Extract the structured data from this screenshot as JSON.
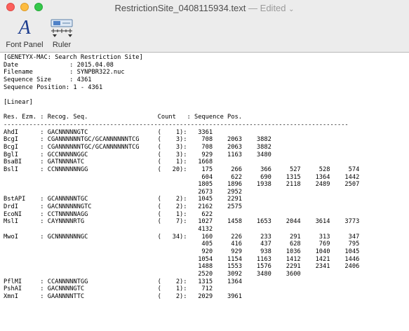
{
  "window": {
    "title": "RestrictionSite_0408115934.text",
    "separator": "—",
    "status": "Edited",
    "status_chevron": "⌄"
  },
  "toolbar": {
    "font_panel_icon": "A",
    "font_panel_label": "Font Panel",
    "ruler_label": "Ruler"
  },
  "document": {
    "lines": [
      "[GENETYX-MAC: Search Restriction Site]",
      "Date              : 2015.04.08",
      "Filename          : SYNPBR322.nuc",
      "Sequence Size     : 4361",
      "Sequence Position: 1 - 4361",
      "",
      "[Linear]",
      "",
      "Res. Ezm. : Recog. Seq.                   Count   : Sequence Pos.",
      "----------------------------------------------------------------------------------------------",
      "AhdI      : GACNNNNNGTC                   (    1):   3361",
      "BcgI      : CGANNNNNNTGC/GCANNNNNNTCG     (    3):    708    2063    3882",
      "BcgI      : CGANNNNNNTGC/GCANNNNNNTCG     (    3):    708    2063    3882",
      "BglI      : GCCNNNNNGGC                   (    3):    929    1163    3480",
      "BsaBI     : GATNNNNATC                    (    1):   1668",
      "BslI      : CCNNNNNNNGG                   (   20):    175     266     366     527     528     574",
      "                                                      604     622     690    1315    1364    1442",
      "                                                     1805    1896    1938    2118    2489    2507",
      "                                                     2673    2952",
      "BstAPI    : GCANNNNNTGC                   (    2):   1045    2291",
      "DrdI      : GACNNNNNNGTC                  (    2):   2162    2575",
      "EcoNI     : CCTNNNNNAGG                   (    1):    622",
      "MslI      : CAYNNNNRTG                    (    7):   1027    1458    1653    2044    3614    3773",
      "                                                     4132",
      "MwoI      : GCNNNNNNNGC                   (   34):    160     226     233     291     313     347",
      "                                                      405     416     437     628     769     795",
      "                                                      920     929     938    1036    1040    1045",
      "                                                     1054    1154    1163    1412    1421    1446",
      "                                                     1488    1553    1576    2291    2341    2406",
      "                                                     2520    3092    3480    3600",
      "PflMI     : CCANNNNNTGG                   (    2):   1315    1364",
      "PshAI     : GACNNNNGTC                    (    1):    712",
      "XmnI      : GAANNNNTTC                    (    2):   2029    3961"
    ]
  }
}
